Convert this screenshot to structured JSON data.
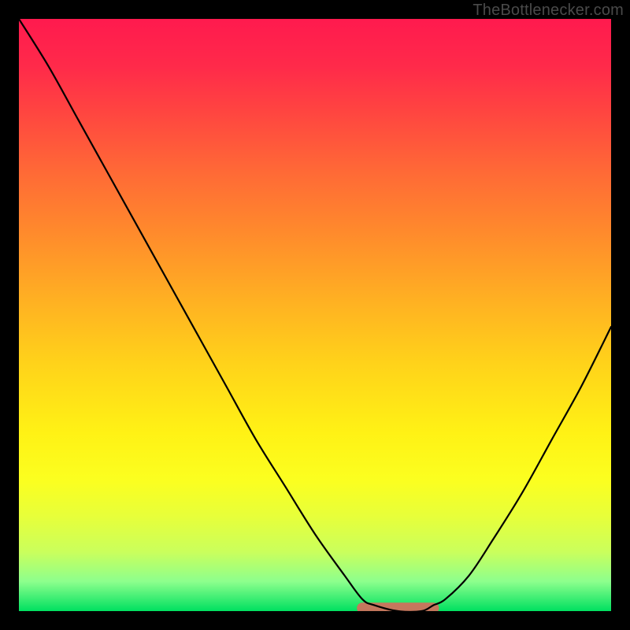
{
  "watermark": "TheBottlenecker.com",
  "chart_data": {
    "type": "line",
    "title": "",
    "xlabel": "",
    "ylabel": "",
    "xlim": [
      0,
      100
    ],
    "ylim": [
      0,
      100
    ],
    "grid": false,
    "series": [
      {
        "name": "bottleneck-curve",
        "x": [
          0,
          5,
          10,
          15,
          20,
          25,
          30,
          35,
          40,
          45,
          50,
          55,
          58,
          60,
          64,
          68,
          70,
          72,
          76,
          80,
          85,
          90,
          95,
          100
        ],
        "values": [
          100,
          92,
          83,
          74,
          65,
          56,
          47,
          38,
          29,
          21,
          13,
          6,
          2,
          1,
          0,
          0,
          1,
          2,
          6,
          12,
          20,
          29,
          38,
          48
        ]
      }
    ],
    "highlight": {
      "name": "optimal-range",
      "x_start": 58,
      "x_end": 70,
      "y": 0.5
    },
    "background_gradient": {
      "top": "#ff1a4e",
      "bottom": "#00e060",
      "meaning": "red=bottleneck, green=balanced"
    }
  }
}
